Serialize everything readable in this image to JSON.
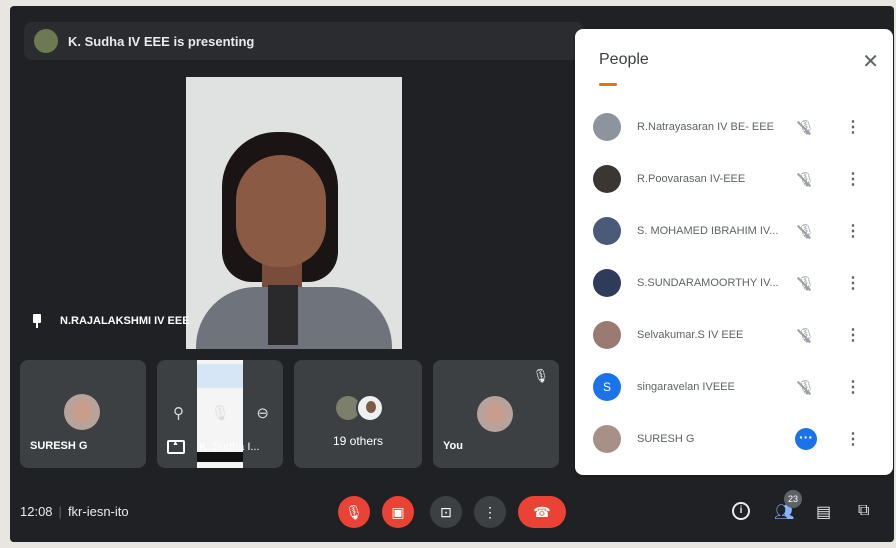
{
  "presenting": {
    "text": "K. Sudha IV EEE is presenting"
  },
  "main_video": {
    "pinned_name": "N.RAJALAKSHMI IV EEE"
  },
  "tiles": {
    "suresh": "SURESH G",
    "presenter_mini": "K. Sudha I...",
    "others": "19 others",
    "you": "You"
  },
  "people_panel": {
    "title": "People",
    "close_icon": "close-icon",
    "participants": [
      {
        "name": "R.Natrayasaran IV BE- EEE",
        "mic": "muted"
      },
      {
        "name": "R.Poovarasan IV-EEE",
        "mic": "muted"
      },
      {
        "name": "S. MOHAMED IBRAHIM IV...",
        "mic": "muted"
      },
      {
        "name": "S.SUNDARAMOORTHY IV...",
        "mic": "muted"
      },
      {
        "name": "Selvakumar.S IV EEE",
        "mic": "muted"
      },
      {
        "name": "singaravelan IVEEE",
        "mic": "muted",
        "avatar_letter": "S"
      },
      {
        "name": "SURESH G",
        "mic": "speaking"
      }
    ]
  },
  "bottom_bar": {
    "time": "12:08",
    "meeting_code": "fkr-iesn-ito",
    "participant_count": "23"
  },
  "colors": {
    "danger": "#ea4335",
    "accent": "#1a73e8",
    "surface": "#202124"
  }
}
